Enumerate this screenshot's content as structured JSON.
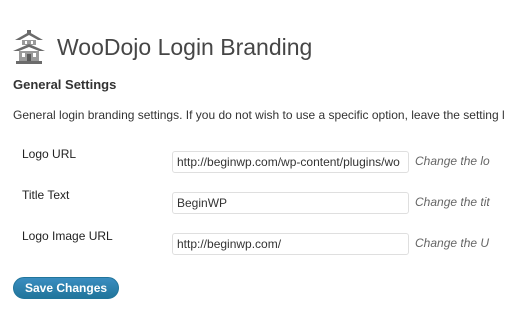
{
  "header": {
    "icon": "pagoda-icon",
    "title": "WooDojo Login Branding"
  },
  "section": {
    "title": "General Settings",
    "description": "General login branding settings. If you do not wish to use a specific option, leave the setting l"
  },
  "fields": [
    {
      "label": "Logo URL",
      "value": "http://beginwp.com/wp-content/plugins/wo",
      "hint": "Change the lo"
    },
    {
      "label": "Title Text",
      "value": "BeginWP",
      "hint": "Change the tit"
    },
    {
      "label": "Logo Image URL",
      "value": "http://beginwp.com/",
      "hint": "Change the U"
    }
  ],
  "actions": {
    "save_label": "Save Changes"
  },
  "colors": {
    "accent": "#21759b",
    "title": "#464646"
  }
}
